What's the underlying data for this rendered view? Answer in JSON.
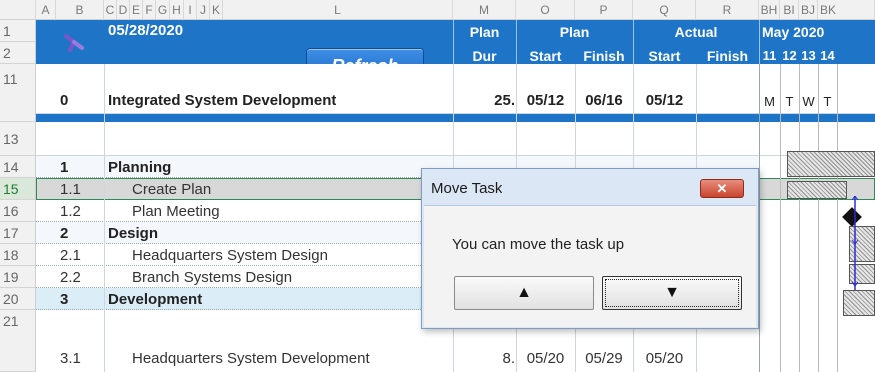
{
  "columns": [
    "A",
    "B",
    "C",
    "D",
    "E",
    "F",
    "G",
    "H",
    "I",
    "J",
    "K",
    "L",
    "M",
    "O",
    "P",
    "Q",
    "R",
    "BH",
    "BI",
    "BJ",
    "BK"
  ],
  "rows": [
    "1",
    "2",
    "11",
    "13",
    "14",
    "15",
    "16",
    "17",
    "18",
    "19",
    "20",
    "21"
  ],
  "header": {
    "date": "05/28/2020",
    "refresh_label": "Refresh",
    "plan_dur_1": "Plan",
    "plan_dur_2": "Dur",
    "plan": "Plan",
    "actual": "Actual",
    "start": "Start",
    "finish": "Finish",
    "actual_start": "Start",
    "actual_finish": "Finish",
    "month": "May 2020",
    "days": [
      "11",
      "12",
      "13",
      "14"
    ],
    "weekdays": [
      "M",
      "T",
      "W",
      "T"
    ]
  },
  "tasks": [
    {
      "wbs": "0",
      "name": "Integrated System Development",
      "dur": "25.",
      "start": "05/12",
      "finish": "06/16",
      "astart": "05/12",
      "afinish": ""
    },
    {
      "wbs": "1",
      "name": "Planning",
      "dur": "",
      "start": "",
      "finish": "",
      "astart": "",
      "afinish": ""
    },
    {
      "wbs": "1.1",
      "name": "Create Plan",
      "dur": "",
      "start": "",
      "finish": "",
      "astart": "",
      "afinish": ""
    },
    {
      "wbs": "1.2",
      "name": "Plan Meeting",
      "dur": "",
      "start": "",
      "finish": "",
      "astart": "",
      "afinish": ""
    },
    {
      "wbs": "2",
      "name": "Design",
      "dur": "",
      "start": "",
      "finish": "",
      "astart": "",
      "afinish": ""
    },
    {
      "wbs": "2.1",
      "name": "Headquarters System Design",
      "dur": "",
      "start": "",
      "finish": "",
      "astart": "",
      "afinish": ""
    },
    {
      "wbs": "2.2",
      "name": "Branch Systems Design",
      "dur": "",
      "start": "",
      "finish": "",
      "astart": "",
      "afinish": ""
    },
    {
      "wbs": "3",
      "name": "Development",
      "dur": "",
      "start": "",
      "finish": "",
      "astart": "",
      "afinish": ""
    },
    {
      "wbs": "3.1",
      "name": "Headquarters System Development",
      "dur": "8.",
      "start": "05/20",
      "finish": "05/29",
      "astart": "05/20",
      "afinish": ""
    }
  ],
  "dialog": {
    "title": "Move Task",
    "message": "You can move the task up",
    "up_label": "▲",
    "down_label": "▼",
    "close_label": "✕"
  },
  "colors": {
    "header_blue": "#1e75c7",
    "dialog_frame": "#dbe7f5"
  }
}
